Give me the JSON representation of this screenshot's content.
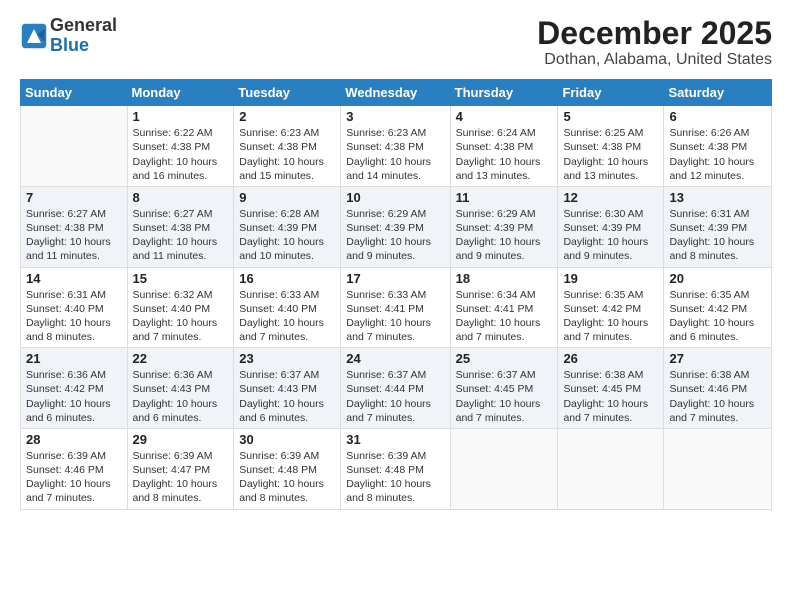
{
  "logo": {
    "line1": "General",
    "line2": "Blue"
  },
  "title": "December 2025",
  "subtitle": "Dothan, Alabama, United States",
  "days_of_week": [
    "Sunday",
    "Monday",
    "Tuesday",
    "Wednesday",
    "Thursday",
    "Friday",
    "Saturday"
  ],
  "weeks": [
    [
      {
        "day": "",
        "info": ""
      },
      {
        "day": "1",
        "info": "Sunrise: 6:22 AM\nSunset: 4:38 PM\nDaylight: 10 hours\nand 16 minutes."
      },
      {
        "day": "2",
        "info": "Sunrise: 6:23 AM\nSunset: 4:38 PM\nDaylight: 10 hours\nand 15 minutes."
      },
      {
        "day": "3",
        "info": "Sunrise: 6:23 AM\nSunset: 4:38 PM\nDaylight: 10 hours\nand 14 minutes."
      },
      {
        "day": "4",
        "info": "Sunrise: 6:24 AM\nSunset: 4:38 PM\nDaylight: 10 hours\nand 13 minutes."
      },
      {
        "day": "5",
        "info": "Sunrise: 6:25 AM\nSunset: 4:38 PM\nDaylight: 10 hours\nand 13 minutes."
      },
      {
        "day": "6",
        "info": "Sunrise: 6:26 AM\nSunset: 4:38 PM\nDaylight: 10 hours\nand 12 minutes."
      }
    ],
    [
      {
        "day": "7",
        "info": "Sunrise: 6:27 AM\nSunset: 4:38 PM\nDaylight: 10 hours\nand 11 minutes."
      },
      {
        "day": "8",
        "info": "Sunrise: 6:27 AM\nSunset: 4:38 PM\nDaylight: 10 hours\nand 11 minutes."
      },
      {
        "day": "9",
        "info": "Sunrise: 6:28 AM\nSunset: 4:39 PM\nDaylight: 10 hours\nand 10 minutes."
      },
      {
        "day": "10",
        "info": "Sunrise: 6:29 AM\nSunset: 4:39 PM\nDaylight: 10 hours\nand 9 minutes."
      },
      {
        "day": "11",
        "info": "Sunrise: 6:29 AM\nSunset: 4:39 PM\nDaylight: 10 hours\nand 9 minutes."
      },
      {
        "day": "12",
        "info": "Sunrise: 6:30 AM\nSunset: 4:39 PM\nDaylight: 10 hours\nand 9 minutes."
      },
      {
        "day": "13",
        "info": "Sunrise: 6:31 AM\nSunset: 4:39 PM\nDaylight: 10 hours\nand 8 minutes."
      }
    ],
    [
      {
        "day": "14",
        "info": "Sunrise: 6:31 AM\nSunset: 4:40 PM\nDaylight: 10 hours\nand 8 minutes."
      },
      {
        "day": "15",
        "info": "Sunrise: 6:32 AM\nSunset: 4:40 PM\nDaylight: 10 hours\nand 7 minutes."
      },
      {
        "day": "16",
        "info": "Sunrise: 6:33 AM\nSunset: 4:40 PM\nDaylight: 10 hours\nand 7 minutes."
      },
      {
        "day": "17",
        "info": "Sunrise: 6:33 AM\nSunset: 4:41 PM\nDaylight: 10 hours\nand 7 minutes."
      },
      {
        "day": "18",
        "info": "Sunrise: 6:34 AM\nSunset: 4:41 PM\nDaylight: 10 hours\nand 7 minutes."
      },
      {
        "day": "19",
        "info": "Sunrise: 6:35 AM\nSunset: 4:42 PM\nDaylight: 10 hours\nand 7 minutes."
      },
      {
        "day": "20",
        "info": "Sunrise: 6:35 AM\nSunset: 4:42 PM\nDaylight: 10 hours\nand 6 minutes."
      }
    ],
    [
      {
        "day": "21",
        "info": "Sunrise: 6:36 AM\nSunset: 4:42 PM\nDaylight: 10 hours\nand 6 minutes."
      },
      {
        "day": "22",
        "info": "Sunrise: 6:36 AM\nSunset: 4:43 PM\nDaylight: 10 hours\nand 6 minutes."
      },
      {
        "day": "23",
        "info": "Sunrise: 6:37 AM\nSunset: 4:43 PM\nDaylight: 10 hours\nand 6 minutes."
      },
      {
        "day": "24",
        "info": "Sunrise: 6:37 AM\nSunset: 4:44 PM\nDaylight: 10 hours\nand 7 minutes."
      },
      {
        "day": "25",
        "info": "Sunrise: 6:37 AM\nSunset: 4:45 PM\nDaylight: 10 hours\nand 7 minutes."
      },
      {
        "day": "26",
        "info": "Sunrise: 6:38 AM\nSunset: 4:45 PM\nDaylight: 10 hours\nand 7 minutes."
      },
      {
        "day": "27",
        "info": "Sunrise: 6:38 AM\nSunset: 4:46 PM\nDaylight: 10 hours\nand 7 minutes."
      }
    ],
    [
      {
        "day": "28",
        "info": "Sunrise: 6:39 AM\nSunset: 4:46 PM\nDaylight: 10 hours\nand 7 minutes."
      },
      {
        "day": "29",
        "info": "Sunrise: 6:39 AM\nSunset: 4:47 PM\nDaylight: 10 hours\nand 8 minutes."
      },
      {
        "day": "30",
        "info": "Sunrise: 6:39 AM\nSunset: 4:48 PM\nDaylight: 10 hours\nand 8 minutes."
      },
      {
        "day": "31",
        "info": "Sunrise: 6:39 AM\nSunset: 4:48 PM\nDaylight: 10 hours\nand 8 minutes."
      },
      {
        "day": "",
        "info": ""
      },
      {
        "day": "",
        "info": ""
      },
      {
        "day": "",
        "info": ""
      }
    ]
  ]
}
